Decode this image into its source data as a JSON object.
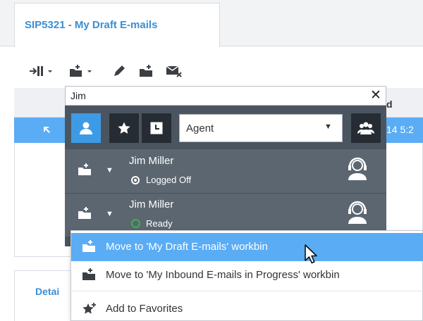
{
  "tab": {
    "title": "SIP5321 - My Draft E-mails"
  },
  "toolbar": {
    "icons": [
      "transfer-icon",
      "move-to-workbin-icon",
      "edit-icon",
      "move-to-inbound-icon",
      "delete-email-icon"
    ]
  },
  "background_table": {
    "column_header_fragment": "d",
    "selected_row_time_fragment": "14 5:2"
  },
  "details": {
    "label": "Detai"
  },
  "search": {
    "value": "Jim"
  },
  "team_communicator": {
    "filter_type": "Agent",
    "agents": [
      {
        "name": "Jim Miller",
        "status": "Logged Off"
      },
      {
        "name": "Jim Miller",
        "status": "Ready"
      }
    ]
  },
  "context_menu": {
    "items": [
      {
        "label": "Move to 'My Draft E-mails' workbin"
      },
      {
        "label": "Move to 'My Inbound E-mails in Progress' workbin"
      },
      {
        "label": "Add to Favorites"
      }
    ]
  },
  "colors": {
    "accent": "#3a8fd4",
    "selection": "#5aacf5",
    "dark_panel": "#4b5560",
    "ready_green": "#38b549"
  }
}
